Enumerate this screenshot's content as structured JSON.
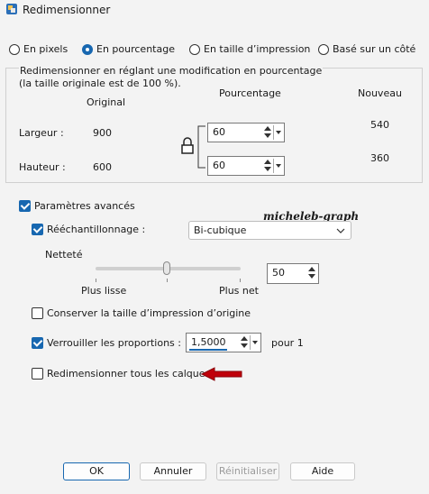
{
  "window": {
    "title": "Redimensionner"
  },
  "mode_options": [
    {
      "label": "En pixels",
      "selected": false
    },
    {
      "label": "En pourcentage",
      "selected": true
    },
    {
      "label": "En taille d’impression",
      "selected": false
    },
    {
      "label": "Basé sur un côté",
      "selected": false
    }
  ],
  "group": {
    "desc_line1": "Redimensionner en réglant une modification en pourcentage",
    "desc_line2": "(la taille originale est de 100 %)."
  },
  "headers": {
    "original": "Original",
    "percentage": "Pourcentage",
    "new": "Nouveau"
  },
  "width": {
    "label": "Largeur :",
    "original": "900",
    "percent": "60",
    "new": "540"
  },
  "height": {
    "label": "Hauteur :",
    "original": "600",
    "percent": "60",
    "new": "360"
  },
  "advanced": {
    "label": "Paramètres avancés",
    "checked": true
  },
  "resample": {
    "label": "Rééchantillonnage :",
    "checked": true,
    "value": "Bi-cubique"
  },
  "watermark": "micheleb-graph",
  "sharpness": {
    "label": "Netteté",
    "value": "50",
    "min_label": "Plus lisse",
    "max_label": "Plus net",
    "level": 0.5
  },
  "keep_print_size": {
    "label": "Conserver la taille d’impression d’origine",
    "checked": false
  },
  "lock_ratio": {
    "label": "Verrouiller les proportions :",
    "checked": true,
    "value": "1,5000",
    "suffix": "pour 1"
  },
  "resize_layers": {
    "label": "Redimensionner tous les calques",
    "checked": false
  },
  "buttons": {
    "ok": "OK",
    "cancel": "Annuler",
    "reset": "Réinitialiser",
    "help": "Aide"
  },
  "colors": {
    "accent": "#1767b0",
    "arrow": "#c0000a"
  }
}
